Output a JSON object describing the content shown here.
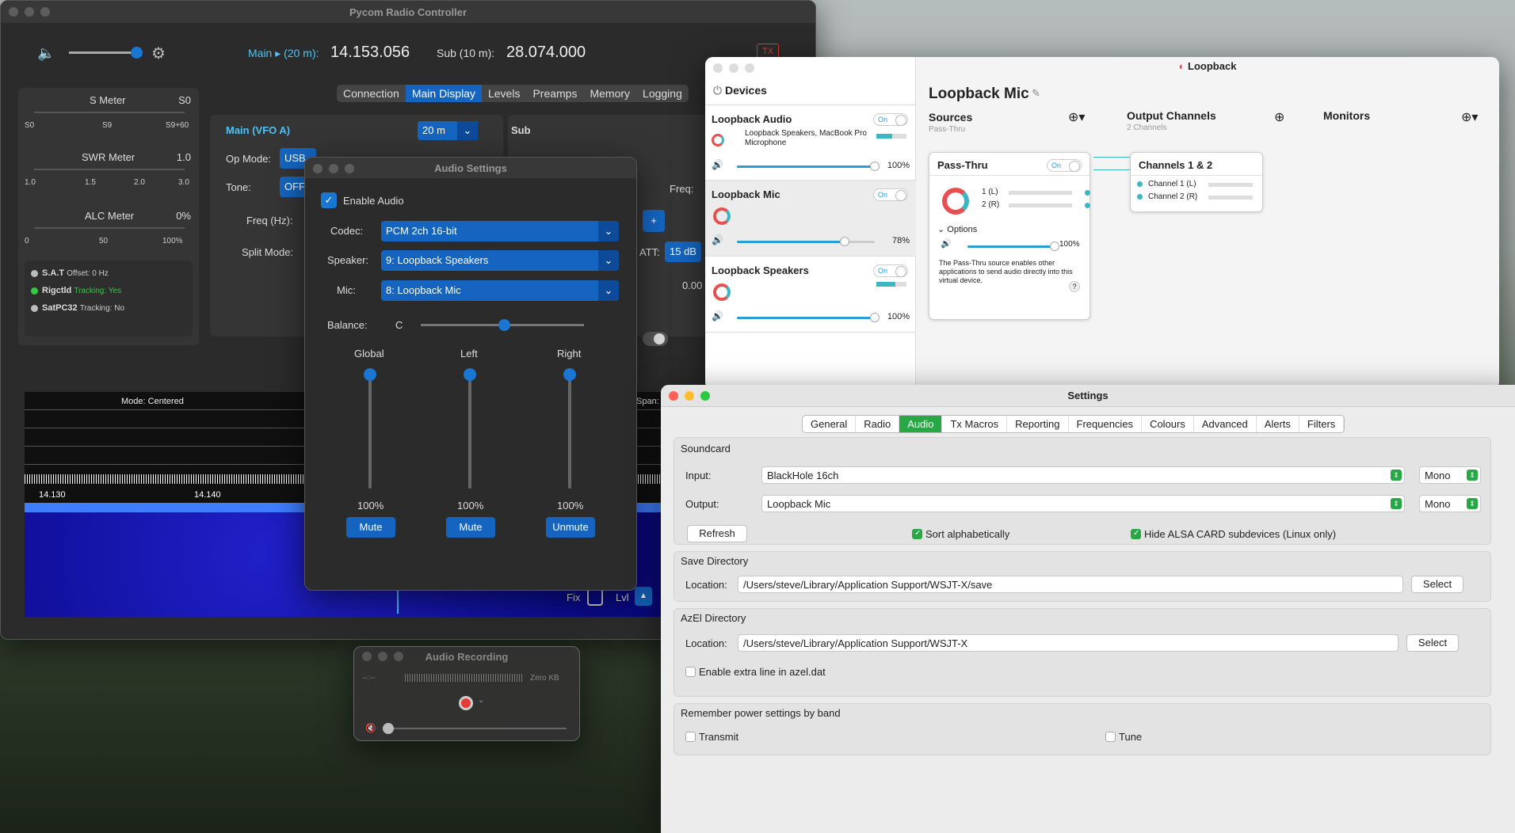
{
  "pycom": {
    "title": "Pycom Radio Controller",
    "main_label": "Main",
    "main_band": "(20 m):",
    "main_freq": "14.153.056",
    "sub_label": "Sub (10 m):",
    "sub_freq": "28.074.000",
    "tx": "TX",
    "tabs": [
      "Connection",
      "Main Display",
      "Levels",
      "Preamps",
      "Memory",
      "Logging"
    ],
    "meters": [
      {
        "name": "S Meter",
        "value": "S0",
        "ticks": [
          "S0",
          "S9",
          "S9+60"
        ]
      },
      {
        "name": "SWR Meter",
        "value": "1.0",
        "ticks": [
          "1.0",
          "1.5",
          "2.0",
          "3.0"
        ]
      },
      {
        "name": "ALC Meter",
        "value": "0%",
        "ticks": [
          "0",
          "50",
          "100%"
        ]
      }
    ],
    "status": [
      {
        "name": "S.A.T",
        "detail": "Offset: 0 Hz",
        "color": "#bbbbbb"
      },
      {
        "name": "Rigctld",
        "detail": "Tracking: Yes",
        "color": "#2ecc40"
      },
      {
        "name": "SatPC32",
        "detail": "Tracking: No",
        "color": "#bbbbbb"
      }
    ],
    "vfo_a": "Main (VFO A)",
    "band": "20 m",
    "sub": "Sub",
    "op_mode": "Op Mode:",
    "op_val": "USB",
    "tone": "Tone:",
    "tone_val": "OFF",
    "freq_hz": "Freq (Hz):",
    "split": "Split Mode:",
    "freq": "Freq:",
    "att": "ATT:",
    "att_val": "15 dB",
    "val_000": "0.00",
    "plus": "+",
    "spec_mode": "Mode: Centered",
    "span": "Span:",
    "f1": "14.130",
    "f2": "14.140",
    "fix": "Fix",
    "lvl": "Lvl"
  },
  "audio": {
    "title": "Audio Settings",
    "enable": "Enable Audio",
    "codec_l": "Codec:",
    "codec": "PCM 2ch 16-bit",
    "speaker_l": "Speaker:",
    "speaker": "9: Loopback Speakers",
    "mic_l": "Mic:",
    "mic": "8: Loopback Mic",
    "balance_l": "Balance:",
    "balance": "C",
    "channels": [
      {
        "name": "Global",
        "pct": "100%",
        "btn": "Mute"
      },
      {
        "name": "Left",
        "pct": "100%",
        "btn": "Mute"
      },
      {
        "name": "Right",
        "pct": "100%",
        "btn": "Unmute"
      }
    ]
  },
  "loopback": {
    "title": "Loopback",
    "devices": "Devices",
    "name": "Loopback Mic",
    "sources": "Sources",
    "sources_sub": "Pass-Thru",
    "outputs": "Output Channels",
    "outputs_sub": "2 Channels",
    "monitors": "Monitors",
    "dev": [
      {
        "name": "Loopback Audio",
        "on": "On",
        "detail": "Loopback Speakers, MacBook Pro Microphone",
        "vol": "100%"
      },
      {
        "name": "Loopback Mic",
        "on": "On",
        "vol": "78%"
      },
      {
        "name": "Loopback Speakers",
        "on": "On",
        "vol": "100%"
      }
    ],
    "pass": "Pass-Thru",
    "pass_on": "On",
    "ch1": "1 (L)",
    "ch2": "2 (R)",
    "options": "Options",
    "opt_vol": "100%",
    "desc": "The Pass-Thru source enables other applications to send audio directly into this virtual device.",
    "help": "?",
    "chcard": "Channels 1 & 2",
    "out1": "Channel 1 (L)",
    "out2": "Channel 2 (R)"
  },
  "settings": {
    "title": "Settings",
    "tabs": [
      "General",
      "Radio",
      "Audio",
      "Tx Macros",
      "Reporting",
      "Frequencies",
      "Colours",
      "Advanced",
      "Alerts",
      "Filters"
    ],
    "soundcard": "Soundcard",
    "input_l": "Input:",
    "input": "BlackHole 16ch",
    "input_ch": "Mono",
    "output_l": "Output:",
    "output": "Loopback Mic",
    "output_ch": "Mono",
    "refresh": "Refresh",
    "sort": "Sort alphabetically",
    "hide_alsa": "Hide ALSA CARD subdevices (Linux only)",
    "save_dir": "Save Directory",
    "loc_l": "Location:",
    "save_path": "/Users/steve/Library/Application Support/WSJT-X/save",
    "select": "Select",
    "azel": "AzEl Directory",
    "azel_path": "/Users/steve/Library/Application Support/WSJT-X",
    "extra": "Enable extra line in azel.dat",
    "remember": "Remember power settings by band",
    "transmit": "Transmit",
    "tune": "Tune"
  },
  "recording": {
    "title": "Audio Recording",
    "time": "--:--",
    "size": "Zero KB"
  }
}
